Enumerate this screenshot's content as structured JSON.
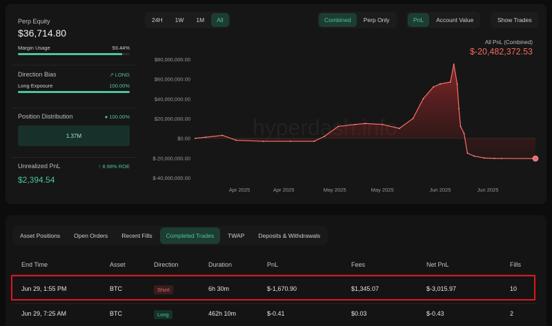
{
  "summary": {
    "perp_equity_label": "Perp Equity",
    "perp_equity_value": "$36,714.80",
    "margin_usage_label": "Margin Usage",
    "margin_usage_value": "93.44%",
    "margin_usage_fraction": 0.9344,
    "direction_bias_label": "Direction Bias",
    "direction_bias_value": "LONG",
    "long_exposure_label": "Long Exposure",
    "long_exposure_value": "100.00%",
    "long_exposure_fraction": 1.0,
    "position_distribution_label": "Position Distribution",
    "position_distribution_value": "100.00%",
    "position_distribution_amount": "1.37M",
    "unrealized_pnl_label": "Unrealized PnL",
    "unrealized_roe": "8.98% ROE",
    "unrealized_pnl_value": "$2,394.54"
  },
  "timeframes": [
    "24H",
    "1W",
    "1M",
    "All"
  ],
  "active_timeframe": "All",
  "view_modes": [
    "Combined",
    "Perp Only"
  ],
  "active_view_mode": "Combined",
  "metrics": [
    "PnL",
    "Account Value"
  ],
  "active_metric": "PnL",
  "show_trades_label": "Show Trades",
  "pnl_title": "All PnL (Combined)",
  "pnl_value": "$-20,482,372.53",
  "watermark": "hyperdash.info",
  "colors": {
    "accent": "#4fc59a",
    "loss": "#f06a62",
    "highlight_border": "#e0161c"
  },
  "chart_data": {
    "type": "area",
    "ylim": [
      -40000000,
      80000000
    ],
    "y_ticks": [
      "$80,000,000.00",
      "$60,000,000.00",
      "$40,000,000.00",
      "$20,000,000.00",
      "$0.00",
      "$-20,000,000.00",
      "$-40,000,000.00"
    ],
    "y_tick_values": [
      80000000,
      60000000,
      40000000,
      20000000,
      0,
      -20000000,
      -40000000
    ],
    "x_ticks": [
      "Apr 2025",
      "Apr 2025",
      "May 2025",
      "May 2025",
      "Jun 2025",
      "Jun 2025"
    ],
    "x": [
      0,
      0.03,
      0.08,
      0.12,
      0.2,
      0.28,
      0.35,
      0.38,
      0.42,
      0.47,
      0.5,
      0.55,
      0.6,
      0.64,
      0.67,
      0.7,
      0.72,
      0.75,
      0.76,
      0.77,
      0.775,
      0.78,
      0.79,
      0.8,
      0.82,
      0.85,
      0.88,
      0.9,
      1.0
    ],
    "series": [
      {
        "values": [
          0,
          1000000,
          3000000,
          -2000000,
          -3000000,
          -3000000,
          -3000000,
          2000000,
          12000000,
          14000000,
          15000000,
          14000000,
          10000000,
          20000000,
          40000000,
          52000000,
          55000000,
          57000000,
          75000000,
          55000000,
          30000000,
          12000000,
          5000000,
          -15000000,
          -18000000,
          -20000000,
          -20300000,
          -20400000,
          -20482372
        ]
      }
    ]
  },
  "tabs": [
    "Asset Positions",
    "Open Orders",
    "Recent Fills",
    "Completed Trades",
    "TWAP",
    "Deposits & Withdrawals"
  ],
  "active_tab": "Completed Trades",
  "table": {
    "headers": [
      "End Time",
      "Asset",
      "Direction",
      "Duration",
      "PnL",
      "Fees",
      "Net PnL",
      "Fills"
    ],
    "rows": [
      [
        "Jun 29, 1:55 PM",
        "BTC",
        "Short",
        "6h 30m",
        "$-1,670.90",
        "$1,345.07",
        "$-3,015.97",
        "10"
      ],
      [
        "Jun 29, 7:25 AM",
        "BTC",
        "Long",
        "462h 10m",
        "$-0.41",
        "$0.03",
        "$-0.43",
        "2"
      ]
    ]
  }
}
